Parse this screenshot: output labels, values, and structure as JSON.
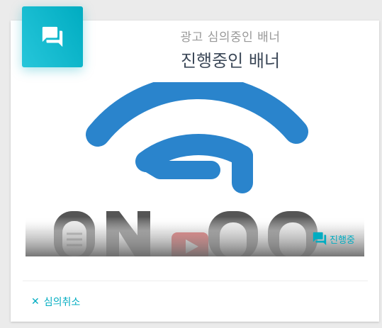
{
  "card": {
    "category": "광고 심의중인 배너",
    "title": "진행중인 배너",
    "header_icon": "chat-bubbles-icon",
    "accent_color": "#00acc1"
  },
  "banner": {
    "brand_text": "ON  OP",
    "status_label": "진행중",
    "status_icon": "chat-bubbles-icon",
    "logo_colors": {
      "arc": "#2a84cc",
      "letters": "#555555",
      "play": "#d81e1e"
    }
  },
  "actions": {
    "cancel_label": "심의취소",
    "cancel_icon": "close-icon"
  }
}
